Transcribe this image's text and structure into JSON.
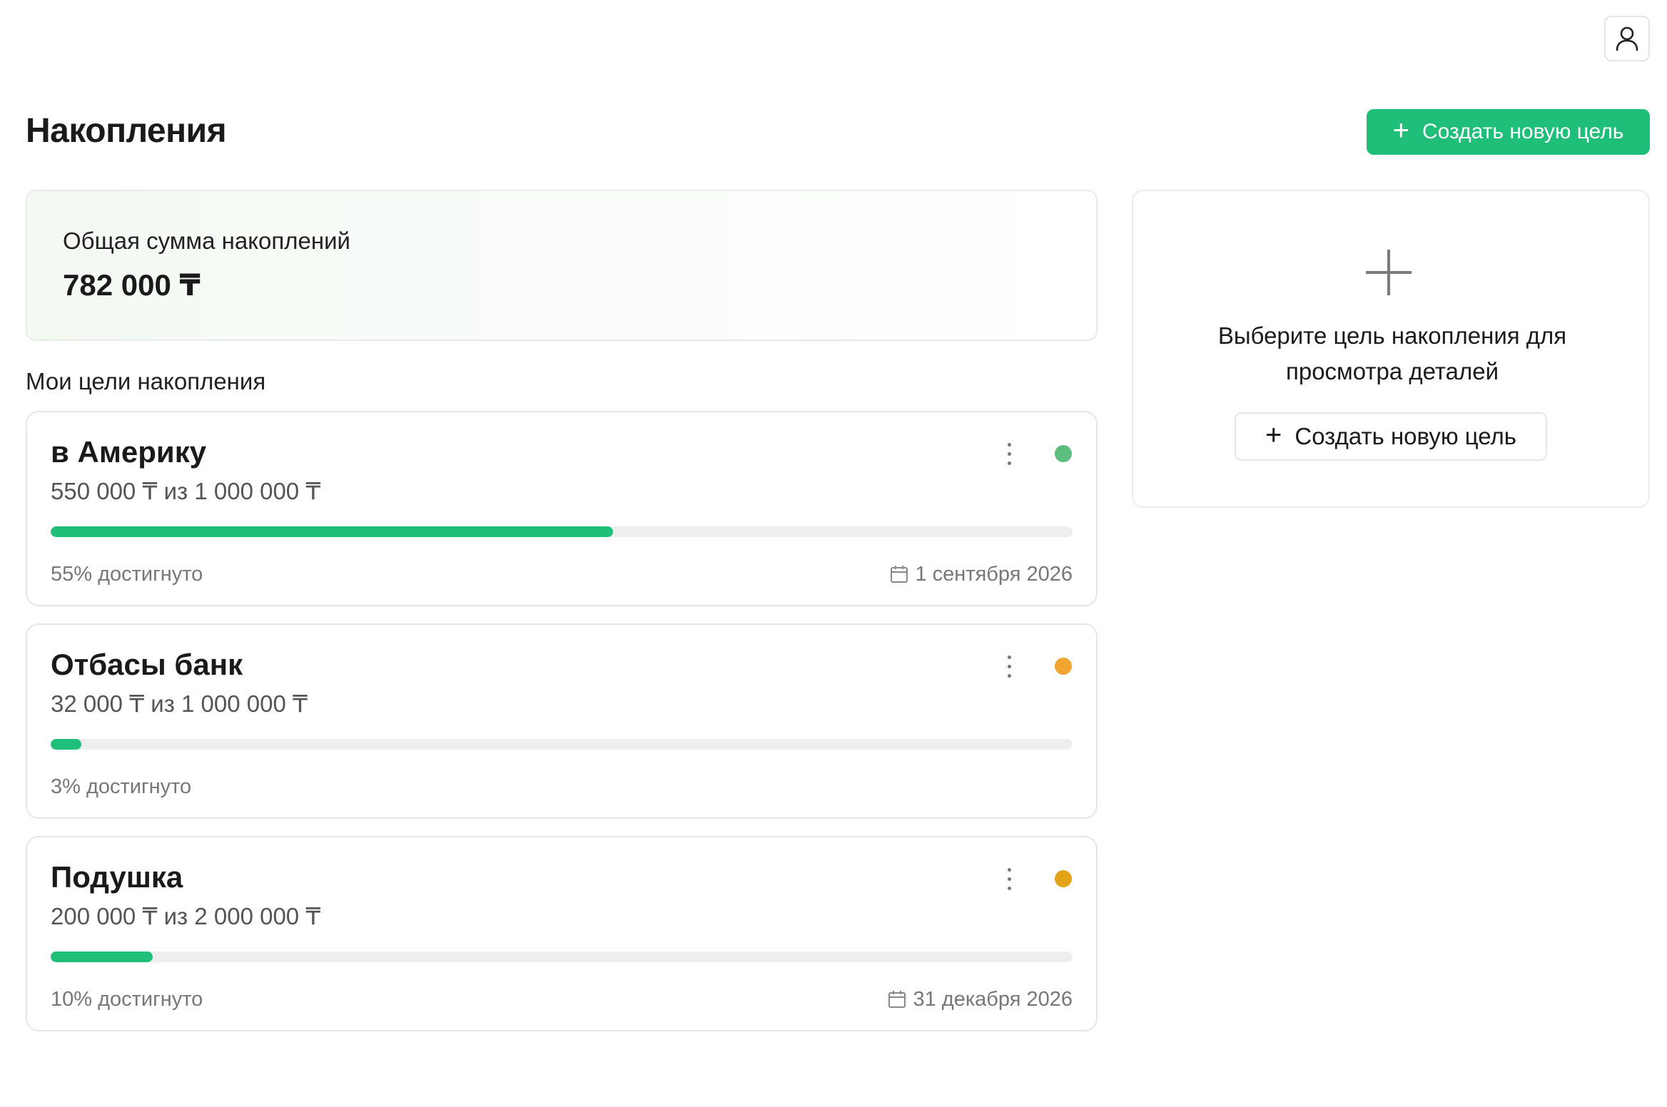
{
  "header": {
    "title": "Накопления",
    "create_button_label": "Создать новую цель",
    "user_icon": "user-icon"
  },
  "summary": {
    "label": "Общая сумма накоплений",
    "value": "782 000 ₸"
  },
  "goals_section": {
    "title": "Мои цели накопления",
    "goals": [
      {
        "name": "в Америку",
        "amount": "550 000 ₸ из 1 000 000 ₸",
        "progress": 0.55,
        "percent_label": "55% достигнуто",
        "date": "1 сентября 2026",
        "status_color": "#5cbf7f"
      },
      {
        "name": "Отбасы банк",
        "amount": "32 000 ₸ из 1 000 000 ₸",
        "progress": 0.03,
        "percent_label": "3% достигнуто",
        "date": "",
        "status_color": "#f2a531"
      },
      {
        "name": "Подушка",
        "amount": "200 000 ₸ из 2 000 000 ₸",
        "progress": 0.1,
        "percent_label": "10% достигнуто",
        "date": "31 декабря 2026",
        "status_color": "#e3a319"
      }
    ]
  },
  "detail_panel": {
    "message": "Выберите цель накопления для просмотра деталей",
    "button_label": "Создать новую цель"
  },
  "colors": {
    "accent": "#1fbf7a",
    "track": "#eeeeee"
  }
}
